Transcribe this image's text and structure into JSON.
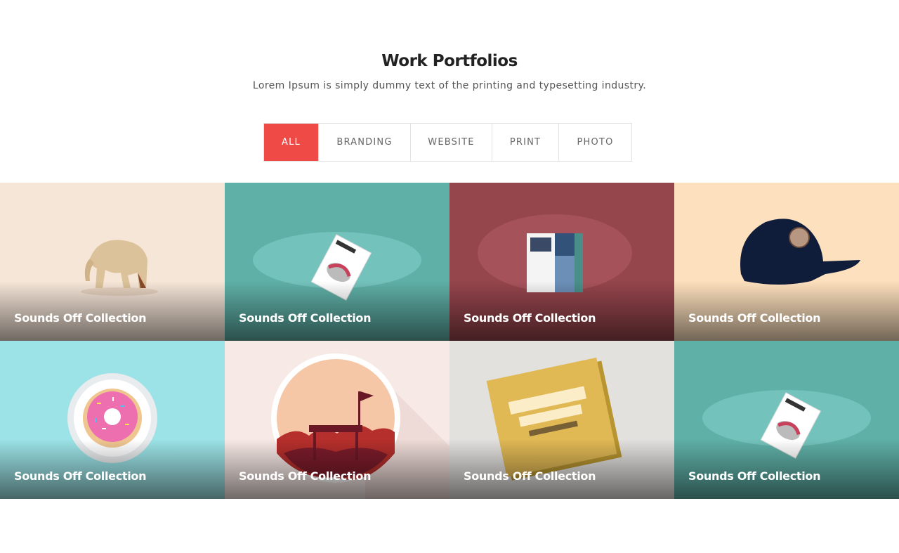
{
  "header": {
    "title": "Work Portfolios",
    "subtitle": "Lorem Ipsum is simply dummy text of the printing and typesetting industry."
  },
  "filters": [
    {
      "label": "ALL",
      "active": true
    },
    {
      "label": "BRANDING",
      "active": false
    },
    {
      "label": "WEBSITE",
      "active": false
    },
    {
      "label": "PRINT",
      "active": false
    },
    {
      "label": "PHOTO",
      "active": false
    }
  ],
  "colors": {
    "accent": "#f04a47"
  },
  "portfolio": [
    {
      "caption": "Sounds Off Collection",
      "image": "wooden-elephant-icon",
      "background": "#f6e6d8"
    },
    {
      "caption": "Sounds Off Collection",
      "image": "magazine-mockup-icon",
      "background": "#5fb0a7"
    },
    {
      "caption": "Sounds Off Collection",
      "image": "open-magazine-icon",
      "background": "#95454c"
    },
    {
      "caption": "Sounds Off Collection",
      "image": "baseball-cap-icon",
      "background": "#fde0bd"
    },
    {
      "caption": "Sounds Off Collection",
      "image": "donut-icon",
      "background": "#9be3e6"
    },
    {
      "caption": "Sounds Off Collection",
      "image": "landscape-badge-icon",
      "background": "#f7e9e6"
    },
    {
      "caption": "Sounds Off Collection",
      "image": "book-mockup-icon",
      "background": "#e3e1de"
    },
    {
      "caption": "Sounds Off Collection",
      "image": "magazine-mockup-icon",
      "background": "#5fb0a7"
    }
  ]
}
